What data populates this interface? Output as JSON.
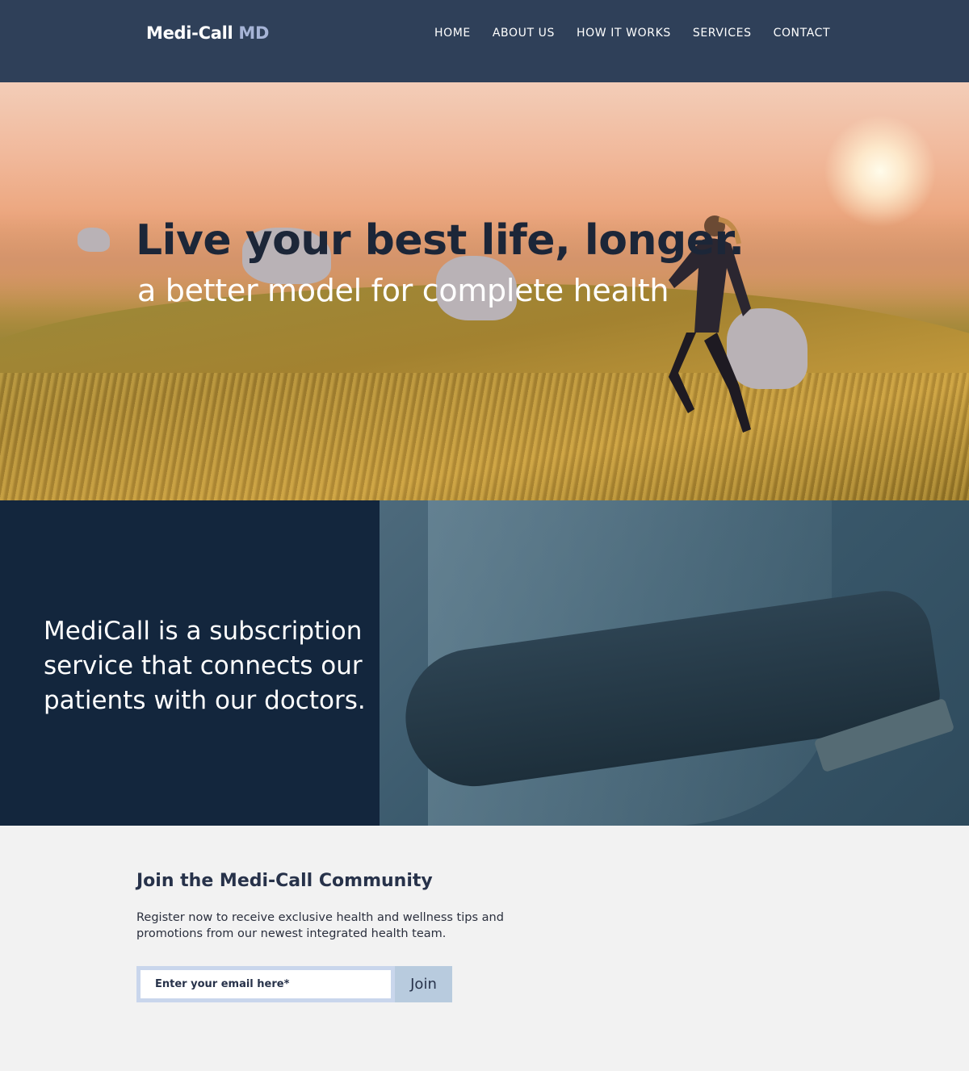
{
  "header": {
    "logo_main": "Medi-Call",
    "logo_suffix": "MD",
    "nav": [
      "HOME",
      "ABOUT US",
      "HOW IT WORKS",
      "SERVICES",
      "CONTACT"
    ]
  },
  "hero": {
    "title": "Live your best life, longer.",
    "subtitle": "a better model for complete health"
  },
  "intro": {
    "text": "MediCall is a subscription service that connects our patients with our doctors."
  },
  "signup": {
    "title": "Join the Medi-Call Community",
    "description": "Register now to receive exclusive health and wellness  tips and promotions from our newest integrated health team.",
    "email_placeholder": "Enter your email here*",
    "button_label": "Join"
  },
  "colors": {
    "header_bg": "#2f4059",
    "logo_accent": "#a6b4d6",
    "intro_bg": "#13263d",
    "page_bg": "#f2f2f2",
    "button_bg": "#b8cbde",
    "input_border": "#c9d6ec"
  }
}
